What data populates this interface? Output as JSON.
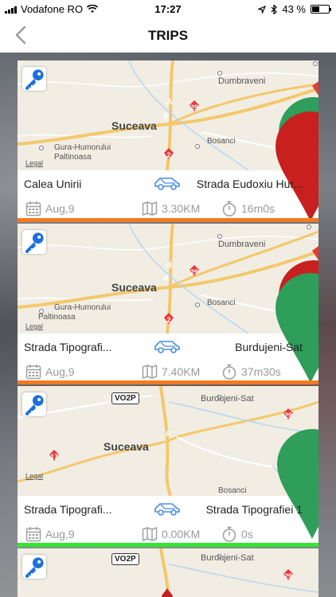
{
  "status_bar": {
    "carrier": "Vodafone RO",
    "time": "17:27",
    "battery": "43 %",
    "battery_level": 0.43
  },
  "nav": {
    "title": "TRIPS"
  },
  "colors": {
    "orange": "#f47a20",
    "green": "#2ee82e",
    "key_blue": "#1e6fd9",
    "car_blue": "#4a8fe0",
    "marker_green": "#2e9e5a",
    "marker_red": "#c8201f"
  },
  "map_labels": {
    "suceava": "Suceava",
    "dumbraveni": "Dumbraveni",
    "bosanci": "Bosanci",
    "gura_humorului": "Gura-Humorului",
    "paltinoasa": "Paltinoasa",
    "burdujeni_sat": "Burdujeni-Sat",
    "vo2p": "VO2P",
    "legal": "Legal",
    "road_29": "29",
    "road_2": "2",
    "road_17": "17",
    "marker_a": "A",
    "marker_b": "B"
  },
  "trips": [
    {
      "from": "Calea Unirii",
      "to": "Strada Eudoxiu Hur...",
      "date": "Aug,9",
      "distance": "3.30KM",
      "duration": "16m0s",
      "bar_color": "orange"
    },
    {
      "from": "Strada Tipografi...",
      "to": "Burdujeni-Sat",
      "date": "Aug,9",
      "distance": "7.40KM",
      "duration": "37m30s",
      "bar_color": "orange"
    },
    {
      "from": "Strada Tipografi...",
      "to": "Strada Tipografiei 1",
      "date": "Aug,9",
      "distance": "0.00KM",
      "duration": "0s",
      "bar_color": "green"
    }
  ]
}
